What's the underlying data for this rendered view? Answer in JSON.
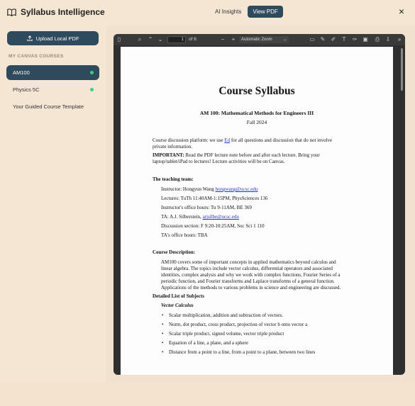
{
  "app": {
    "title": "Syllabus Intelligence",
    "close_glyph": "×"
  },
  "tabs": [
    {
      "label": "AI Insights",
      "active": false
    },
    {
      "label": "View PDF",
      "active": true
    }
  ],
  "sidebar": {
    "upload_label": "Upload Local PDF",
    "section_label": "MY CANVAS COURSES",
    "courses": [
      {
        "label": "AM100",
        "active": true,
        "dot": true
      },
      {
        "label": "Physics 5C",
        "active": false,
        "dot": true
      },
      {
        "label": "Your Guided Course Template",
        "active": false,
        "dot": false
      }
    ]
  },
  "pdf_toolbar": {
    "page_value": "1",
    "page_total": "of 6",
    "zoom": "Automatic Zoom"
  },
  "document": {
    "title": "Course Syllabus",
    "subtitle": "AM 100: Mathematical Methods for Engineers III",
    "term": "Fall 2024",
    "platform_a": "Course discussion platform: we use ",
    "platform_link": "Ed",
    "platform_b": " for all questions and discussion that do not involve",
    "platform_c": "private information.",
    "important_label": "IMPORTANT:",
    "important_a": " Read the PDF lecture note before and after each lecture. Bring your",
    "important_b": "laptop/tablet/iPad to lectures! Lecture activities will be on Canvas.",
    "team_heading": "The teaching team:",
    "instructor_a": "Instructor: Hongyun Wang ",
    "instructor_email": "hongwang@ucsc.edu",
    "lectures": "Lectures:    TuTh 11:40AM-1:15PM, PhysSciences 136",
    "office_hours": "Instructor's office hours: Tu 9-11AM, BE 369",
    "ta_a": "TA: A.J. Silberstein, ",
    "ta_email": "arjsilbe@ucsc.edu",
    "discussion": "Discussion section: F 9:20-10:25AM, Soc Sci 1 110",
    "ta_hours": "TA's office hours: TBA",
    "desc_heading": "Course Description:",
    "desc_lines": [
      "AM100 covers some of important concepts in applied mathematics beyond calculus and",
      "linear algebra. The topics include vector calculus, differential operators and associated",
      "identities, complex analysis and why we work with complex functions, Fourier Series of a",
      "periodic function, and Fourier transforms and Laplace transforms of a general function.",
      "Applications of the methods to various problems in science and engineering are discussed."
    ],
    "subjects_heading": "Detailed List of Subjects",
    "vector_heading": "Vector Calculus",
    "bullets": [
      "Scalar multiplication, addition and subtraction of vectors.",
      "Norm, dot product, cross product, projection of vector b onto vector a",
      "Scalar triple product, signed volume, vector triple product",
      "Equation of a line, a plane, and a sphere",
      "Distance from a point to a line, from a point to a plane, between two lines"
    ]
  },
  "colors": {
    "accent": "#2e4a5c",
    "background": "#f5e6d3",
    "status_dot": "#3fd07a"
  }
}
